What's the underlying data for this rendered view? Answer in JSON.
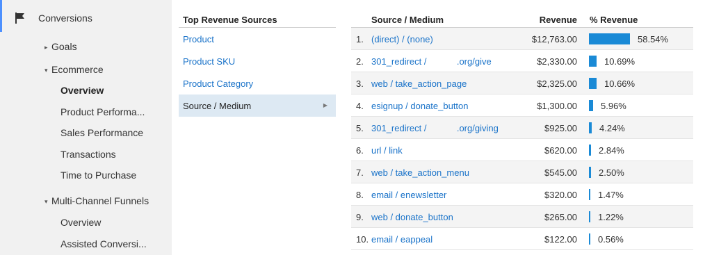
{
  "sidebar": {
    "header": "Conversions",
    "items": [
      {
        "label": "Goals",
        "tri": "▸"
      },
      {
        "label": "Ecommerce",
        "tri": "▾"
      },
      {
        "label": "Overview"
      },
      {
        "label": "Product Performa..."
      },
      {
        "label": "Sales Performance"
      },
      {
        "label": "Transactions"
      },
      {
        "label": "Time to Purchase"
      },
      {
        "label": "Multi-Channel Funnels",
        "tri": "▾"
      },
      {
        "label": "Overview"
      },
      {
        "label": "Assisted Conversi..."
      }
    ]
  },
  "sources_panel": {
    "title": "Top Revenue Sources",
    "items": [
      {
        "label": "Product"
      },
      {
        "label": "Product SKU"
      },
      {
        "label": "Product Category"
      },
      {
        "label": "Source / Medium"
      }
    ]
  },
  "table": {
    "headers": {
      "source": "Source / Medium",
      "revenue": "Revenue",
      "pct": "% Revenue"
    },
    "bar_color": "#1a8ad6",
    "rows": [
      {
        "index": "1.",
        "source": "(direct) / (none)",
        "revenue": "$12,763.00",
        "pct": "58.54%",
        "pct_value": 58.54
      },
      {
        "index": "2.",
        "source": "301_redirect /            .org/give",
        "revenue": "$2,330.00",
        "pct": "10.69%",
        "pct_value": 10.69
      },
      {
        "index": "3.",
        "source": "web / take_action_page",
        "revenue": "$2,325.00",
        "pct": "10.66%",
        "pct_value": 10.66
      },
      {
        "index": "4.",
        "source": "esignup / donate_button",
        "revenue": "$1,300.00",
        "pct": "5.96%",
        "pct_value": 5.96
      },
      {
        "index": "5.",
        "source": "301_redirect /            .org/giving",
        "revenue": "$925.00",
        "pct": "4.24%",
        "pct_value": 4.24
      },
      {
        "index": "6.",
        "source": "url / link",
        "revenue": "$620.00",
        "pct": "2.84%",
        "pct_value": 2.84
      },
      {
        "index": "7.",
        "source": "web / take_action_menu",
        "revenue": "$545.00",
        "pct": "2.50%",
        "pct_value": 2.5
      },
      {
        "index": "8.",
        "source": "email / enewsletter",
        "revenue": "$320.00",
        "pct": "1.47%",
        "pct_value": 1.47
      },
      {
        "index": "9.",
        "source": "web / donate_button",
        "revenue": "$265.00",
        "pct": "1.22%",
        "pct_value": 1.22
      },
      {
        "index": "10.",
        "source": "email / eappeal",
        "revenue": "$122.00",
        "pct": "0.56%",
        "pct_value": 0.56
      }
    ]
  }
}
